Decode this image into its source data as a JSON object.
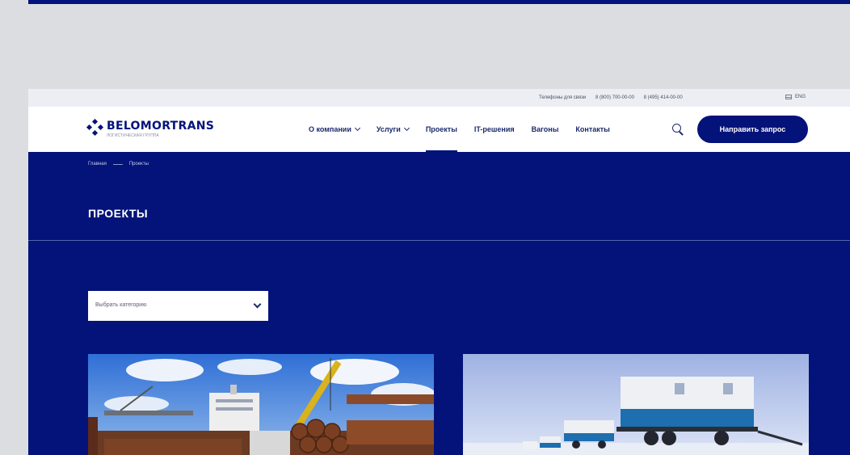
{
  "topbar": {
    "phones": [
      "Телефоны для связи",
      "8 (800) 700-00-00",
      "8 (495) 414-00-00"
    ],
    "lang": "ENG"
  },
  "header": {
    "brand": "BELOMORTRANS",
    "tagline": "ЛОГИСТИЧЕСКАЯ ГРУППА",
    "nav": [
      {
        "label": "О компании"
      },
      {
        "label": "Услуги"
      },
      {
        "label": "Проекты"
      },
      {
        "label": "IT-решения"
      },
      {
        "label": "Вагоны"
      },
      {
        "label": "Контакты"
      }
    ],
    "cta": "Направить запрос"
  },
  "breadcrumb": {
    "home": "Главная",
    "current": "Проекты"
  },
  "page_title": "ПРОЕКТЫ",
  "filter": {
    "placeholder": "Выбрать категорию"
  },
  "colors": {
    "brand": "#03137a",
    "header_bg": "#ffffff",
    "topbar_bg": "#eceef3",
    "outer_bg": "#dcdde1"
  }
}
